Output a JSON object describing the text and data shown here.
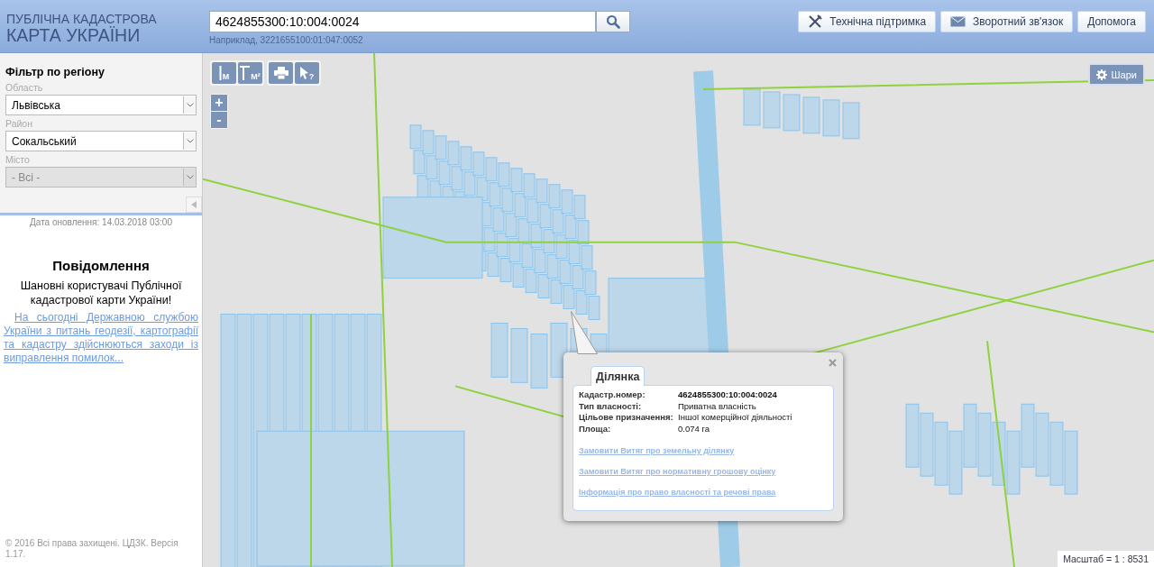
{
  "header": {
    "logo_line_1": "ПУБЛІЧНА КАДАСТРОВА",
    "logo_line_2": "КАРТА УКРАЇНИ",
    "search": {
      "value": "4624855300:10:004:0024",
      "hint": "Наприклад, 3221655100:01:047:0052"
    },
    "buttons": [
      {
        "label": "Технічна підтримка",
        "kind": "tools"
      },
      {
        "label": "Зворотний зв'язок",
        "kind": "mail"
      },
      {
        "label": "Допомога",
        "kind": "plain"
      }
    ]
  },
  "sidebar": {
    "filter_title": "Фільтр по регіону",
    "fields": [
      {
        "label": "Область",
        "value": "Львівська",
        "disabled": false
      },
      {
        "label": "Район",
        "value": "Сокальський",
        "disabled": false
      },
      {
        "label": "Місто",
        "value": "- Всі -",
        "disabled": true
      }
    ],
    "update_date": "Дата оновлення: 14.03.2018 03:00",
    "notice_title": "Повідомлення",
    "notice_greeting": "Шановні користувачі Публічної кадастрової карти України!",
    "notice_link": "На сьогодні Державною службою України з питань геодезії, картографії та кадастру здійснюються заходи із виправлення помилок...",
    "footer": "© 2016 Всі права захищені. ЦДЗК. Версія 1.17."
  },
  "map": {
    "tools": [
      {
        "kind": "ruler",
        "mark": "M"
      },
      {
        "kind": "area",
        "mark": "M²"
      },
      {
        "kind": "print"
      },
      {
        "kind": "identify",
        "mark": "?"
      }
    ],
    "zoom_in": "+",
    "zoom_out": "-",
    "layers_button": "Шари",
    "scale": "Масштаб = 1 : 8531",
    "popup": {
      "tab": "Ділянка",
      "rows": [
        {
          "label": "Кадастр.номер:",
          "value": "4624855300:10:004:0024",
          "bold": true
        },
        {
          "label": "Тип власності:",
          "value": "Приватна власність",
          "bold": false
        },
        {
          "label": "Цільове призначення:",
          "value": "Іншої комерційної діяльності",
          "bold": false
        },
        {
          "label": "Площа:",
          "value": "0.074 га",
          "bold": false
        }
      ],
      "links": [
        "Замовити Витяг про земельну ділянку",
        "Замовити Витяг про нормативну грошову оцінку",
        "Інформація про право власності та речові права"
      ]
    }
  }
}
